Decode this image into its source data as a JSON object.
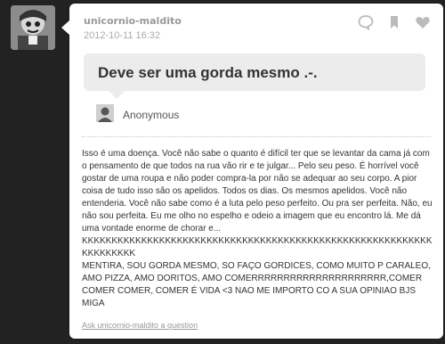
{
  "post": {
    "username": "unicornio-maldito",
    "timestamp": "2012-10-11 16:32",
    "actions": [
      "reply-icon",
      "bookmark-icon",
      "heart-icon"
    ]
  },
  "question": {
    "text": "Deve ser uma gorda mesmo .-.",
    "asker": "Anonymous"
  },
  "answer": {
    "paragraph": "Isso é uma doença. Você não sabe o quanto é difícil ter que se levantar da cama já com o pensamento de que todos na rua vão rir e te julgar... Pelo seu peso. É horrível você gostar de uma roupa e não poder compra-la por não se adequar ao seu corpo. A pior coisa de tudo isso são os apelidos. Todos os dias. Os mesmos apelidos. Você não entenderia. Você não sabe como é a luta pelo peso perfeito. Ou pra ser perfeita. Não, eu não sou perfeita. Eu me olho no espelho e odeio a imagem que eu encontro lá. Me dá uma vontade enorme de chorar e...",
    "laugh": "KKKKKKKKKKKKKKKKKKKKKKKKKKKKKKKKKKKKKKKKKKKKKKKKKKKKKKKKKKKKKKKKKKKK",
    "caps": "MENTIRA, SOU GORDA MESMO, SO FAÇO GORDICES, COMO MUITO P CARALEO, AMO PIZZA, AMO DORITOS, AMO COMERRRRRRRRRRRRRRRRRRRRR,COMER COMER COMER, COMER É VIDA <3 NAO ME IMPORTO CO A SUA OPINIAO BJS MIGA"
  },
  "footer": {
    "ask_link": "Ask unicornio-maldito a question"
  },
  "colors": {
    "background": "#1a1a1a",
    "card": "#ffffff",
    "question_bg": "#ececec"
  }
}
